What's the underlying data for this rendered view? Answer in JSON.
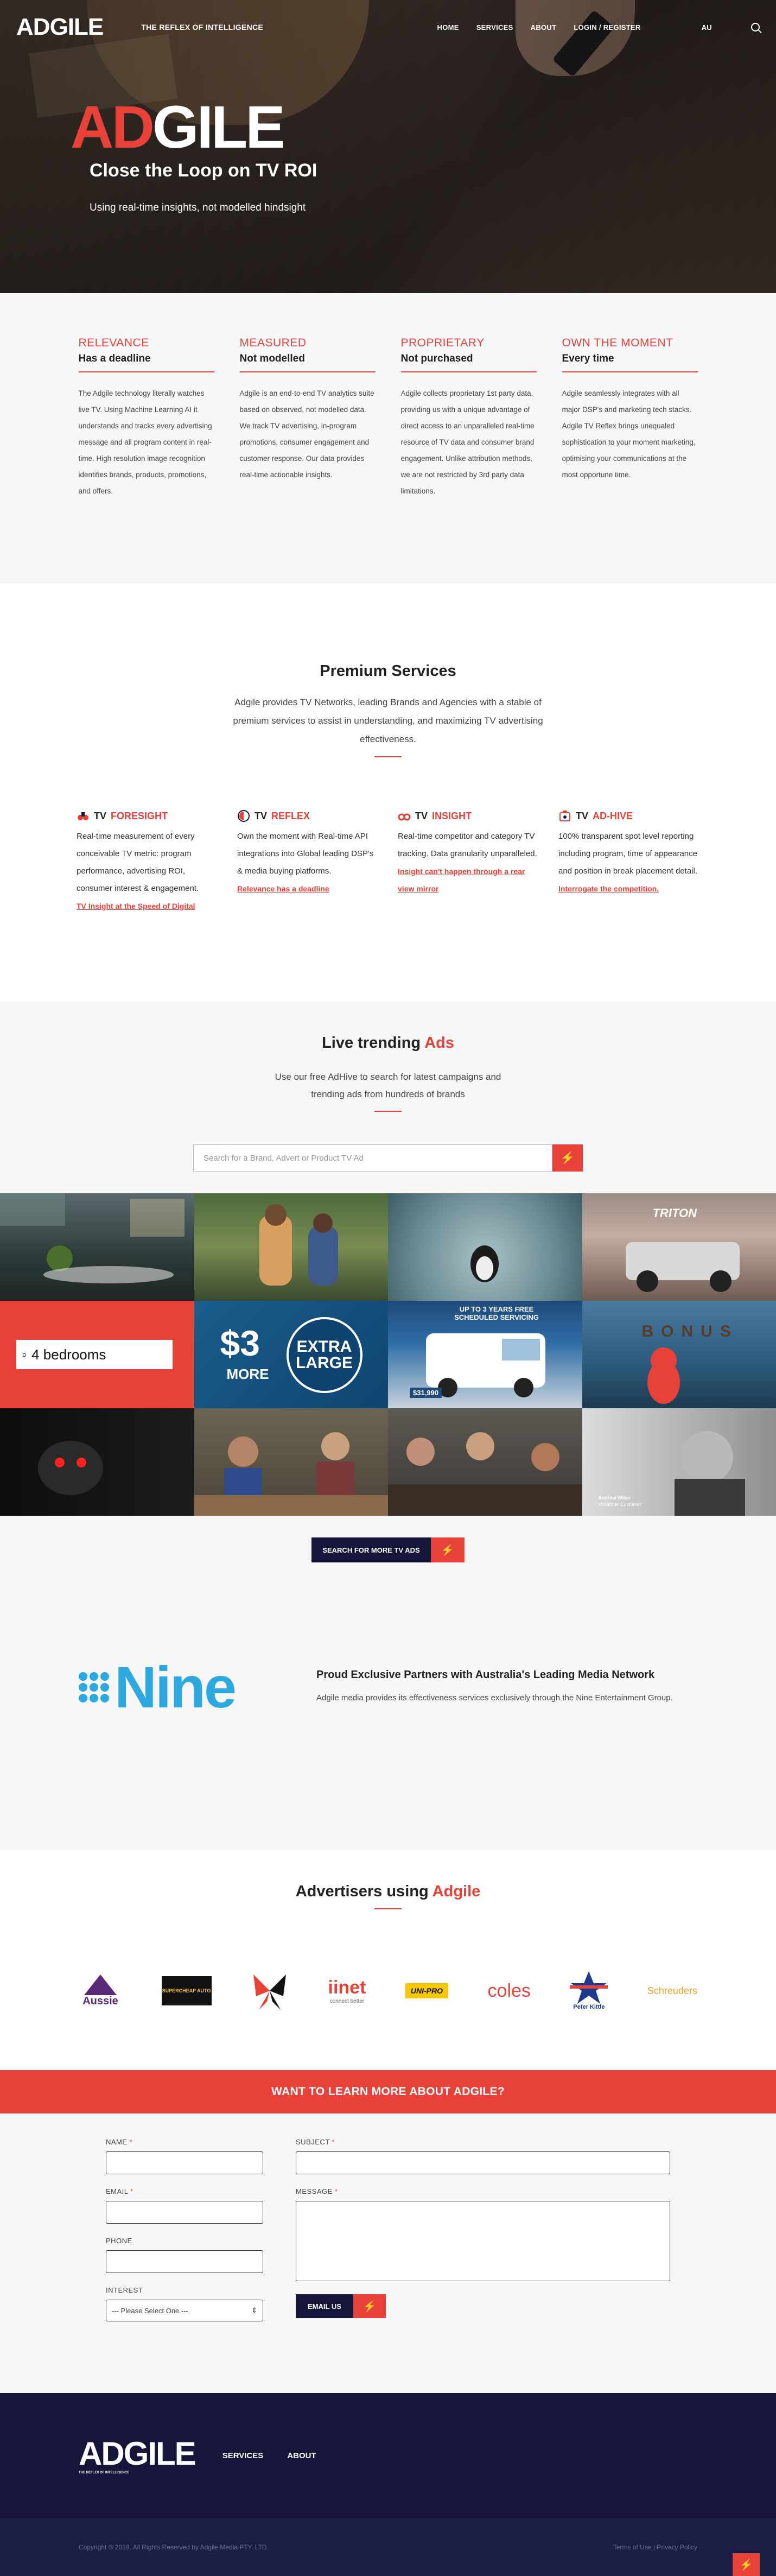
{
  "header": {
    "logo_ad": "AD",
    "logo_gile": "GILE",
    "tagline": "THE REFLEX OF INTELLIGENCE",
    "nav": [
      "HOME",
      "SERVICES",
      "ABOUT",
      "LOGIN / REGISTER"
    ],
    "region": "AU",
    "search_icon": "search-icon"
  },
  "hero": {
    "logo_ad": "AD",
    "logo_gile": "GILE",
    "title": "Close the Loop on TV ROI",
    "subtitle": "Using real-time insights, not modelled hindsight"
  },
  "features": [
    {
      "heading": "RELEVANCE",
      "sub": "Has a deadline",
      "text": "The Adgile technology literally watches live TV. Using Machine Learning AI it understands and tracks every advertising message and all program content in real-time. High resolution image recognition identifies brands, products, promotions, and offers."
    },
    {
      "heading": "MEASURED",
      "sub": "Not modelled",
      "text": "Adgile is an end-to-end TV analytics suite based on observed, not modelled data. We track TV advertising, in-program promotions, consumer engagement and customer response. Our data provides real-time actionable insights."
    },
    {
      "heading": "PROPRIETARY",
      "sub": "Not purchased",
      "text": "Adgile collects proprietary 1st party data, providing us with a unique advantage of direct access to an unparalleled real-time resource of TV data and consumer brand engagement. Unlike attribution methods, we are not restricted by 3rd party data limitations."
    },
    {
      "heading": "OWN THE MOMENT",
      "sub": "Every time",
      "text": "Adgile seamlessly integrates with all major DSP's and marketing tech stacks. Adgile TV Reflex brings unequaled sophistication to your moment marketing, optimising your communications at the most opportune time."
    }
  ],
  "services": {
    "title": "Premium Services",
    "lead": "Adgile provides TV Networks, leading Brands and Agencies with a stable of premium services to assist in understanding, and maximizing TV advertising effectiveness.",
    "items": [
      {
        "tv": "TV",
        "name": "FORESIGHT",
        "icon": "binoculars-icon",
        "text": "Real-time measurement of every conceivable TV metric: program performance, advertising ROI, consumer interest & engagement.",
        "link": "TV Insight at the Speed of Digital"
      },
      {
        "tv": "TV",
        "name": "REFLEX",
        "icon": "reflex-icon",
        "text": "Own the moment with Real-time API integrations into Global leading DSP's & media buying platforms.",
        "link": "Relevance has a deadline"
      },
      {
        "tv": "TV",
        "name": "INSIGHT",
        "icon": "insight-icon",
        "text": "Real-time competitor and category TV tracking. Data granularity unparalleled.",
        "link": "Insight can't happen through a rear view mirror"
      },
      {
        "tv": "TV",
        "name": "AD-HIVE",
        "icon": "hive-icon",
        "text": "100% transparent spot level reporting including program, time of appearance and position in break placement detail.",
        "link": "Interrogate the competition."
      }
    ]
  },
  "trending": {
    "title_a": "Live trending ",
    "title_b": "Ads",
    "lead": "Use our free AdHive to search for latest campaigns and trending ads from hundreds of brands",
    "placeholder": "Search for a Brand, Advert or Product TV Ad",
    "tiles": {
      "t4": "TRITON",
      "t5": "4 bedrooms",
      "t6_price": "$3",
      "t6_more": "MORE",
      "t6_badge": "EXTRA LARGE",
      "t7_top": "UP TO 3 YEARS FREE SCHEDULED SERVICING",
      "t7_price": "$31,990",
      "t8": "BONUS",
      "t12_name": "Andrew Wiles",
      "t12_role": "Vodafone Customer"
    },
    "more_button": "SEARCH FOR MORE TV ADS"
  },
  "partner": {
    "brand": "Nine",
    "title": "Proud Exclusive Partners with Australia's Leading Media Network",
    "text": "Adgile media provides its effectiveness services exclusively through the Nine Entertainment Group."
  },
  "advertisers": {
    "title_a": "Advertisers using ",
    "title_b": "Adgile",
    "logos": [
      "Aussie",
      "SUPERCHEAP AUTO",
      "",
      "iinet",
      "UNI-PRO",
      "coles",
      "Peter Kittle",
      "Schreuders"
    ],
    "iinet_sub": "connect better"
  },
  "cta": {
    "title": "WANT TO LEARN MORE ABOUT ADGILE?"
  },
  "form": {
    "name": "NAME",
    "subject": "SUBJECT",
    "email": "EMAIL",
    "message": "MESSAGE",
    "phone": "PHONE",
    "interest": "INTEREST",
    "interest_value": "--- Please Select One ---",
    "required_mark": "*",
    "submit": "EMAIL US"
  },
  "footer": {
    "logo_ad": "AD",
    "logo_gile": "GILE",
    "logo_sub": "THE REFLEX OF INTELLIGENCE",
    "nav": [
      "SERVICES",
      "ABOUT"
    ],
    "copyright": "Copyright © 2019. All Rights Reserved by Adgile Media PTY. LTD.",
    "links": "Terms of Use  |  Privacy Policy"
  },
  "colors": {
    "accent": "#e8413a",
    "navy": "#15163a",
    "nine_blue": "#2ea8e0"
  }
}
